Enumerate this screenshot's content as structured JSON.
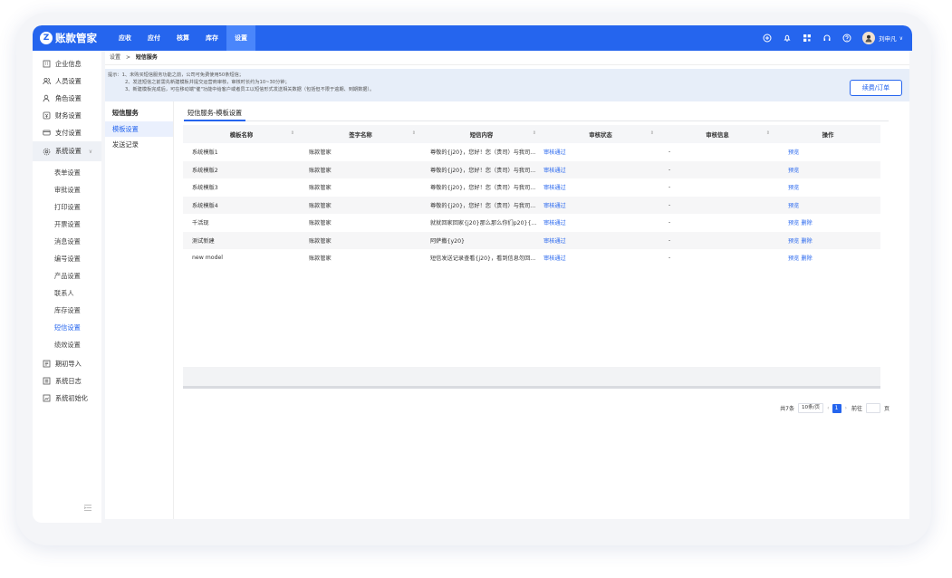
{
  "app": {
    "logo_text": "账款管家",
    "nav": [
      "应收",
      "应付",
      "核算",
      "库存",
      "设置"
    ],
    "active_nav": "设置",
    "username": "刘申凡"
  },
  "sidebar": {
    "items_top": [
      {
        "label": "企业信息",
        "icon": "building-icon"
      },
      {
        "label": "人员设置",
        "icon": "users-icon"
      },
      {
        "label": "角色设置",
        "icon": "role-icon"
      },
      {
        "label": "财务设置",
        "icon": "finance-icon"
      },
      {
        "label": "支付设置",
        "icon": "card-icon"
      }
    ],
    "group": {
      "label": "系统设置",
      "icon": "gear-icon"
    },
    "sub_items": [
      "表单设置",
      "审批设置",
      "打印设置",
      "开票设置",
      "消息设置",
      "编号设置",
      "产品设置",
      "联系人",
      "库存设置",
      "短信设置",
      "绩效设置"
    ],
    "active_sub": "短信设置",
    "items_bottom": [
      {
        "label": "期初导入",
        "icon": "import-icon"
      },
      {
        "label": "系统日志",
        "icon": "log-icon"
      },
      {
        "label": "系统初始化",
        "icon": "init-icon"
      }
    ]
  },
  "breadcrumb": {
    "root": "设置",
    "sep": ">",
    "current": "短信服务"
  },
  "notice": {
    "prefix": "提示：",
    "lines": [
      "1、未购买短信服务功能之前，公司可免费使用50条短信；",
      "2、发送短信之前需先新建模板并提交运营商审核，审核时长约为10~30分钟；",
      "3、新建模板完成后，可在移动端\"催\"功能中给客户或者员工以短信形式发送相关数据（包括但不限于逾期、到期数据）。"
    ],
    "renew_button": "续费/订单"
  },
  "left_menu": {
    "title": "短信服务",
    "items": [
      "模板设置",
      "发送记录"
    ],
    "active": "模板设置"
  },
  "tab": "短信服务-模板设置",
  "table": {
    "columns": [
      "模板名称",
      "签字名称",
      "短信内容",
      "审核状态",
      "审核信息",
      "操作"
    ],
    "rows": [
      {
        "name": "系统模版1",
        "sign": "账款管家",
        "content": "尊敬的{j20}，您好！您（贵司）与我司...",
        "status": "审核通过",
        "info": "-",
        "ops": [
          "预览"
        ]
      },
      {
        "name": "系统模版2",
        "sign": "账款管家",
        "content": "尊敬的{j20}，您好！您（贵司）与我司...",
        "status": "审核通过",
        "info": "-",
        "ops": [
          "预览"
        ]
      },
      {
        "name": "系统模版3",
        "sign": "账款管家",
        "content": "尊敬的{j20}，您好！您（贵司）与我司...",
        "status": "审核通过",
        "info": "-",
        "ops": [
          "预览"
        ]
      },
      {
        "name": "系统模版4",
        "sign": "账款管家",
        "content": "尊敬的{j20}，您好！您（贵司）与我司...",
        "status": "审核通过",
        "info": "-",
        "ops": [
          "预览"
        ]
      },
      {
        "name": "千活现",
        "sign": "账款管家",
        "content": "就就回家回家{j20}那么那么你们p20}{...",
        "status": "审核通过",
        "info": "-",
        "ops": [
          "预览",
          "删除"
        ]
      },
      {
        "name": "测试新建",
        "sign": "账款管家",
        "content": "阿萨撒{y20}",
        "status": "审核通过",
        "info": "-",
        "ops": [
          "预览",
          "删除"
        ]
      },
      {
        "name": "new model",
        "sign": "账款管家",
        "content": "短信发送记录查看{j20}，看到信息勿回...",
        "status": "审核通过",
        "info": "-",
        "ops": [
          "预览",
          "删除"
        ]
      }
    ]
  },
  "pager": {
    "total": "共7条",
    "page_size": "10条/页",
    "current_page": "1",
    "goto_label": "前往",
    "page_label": "页"
  }
}
